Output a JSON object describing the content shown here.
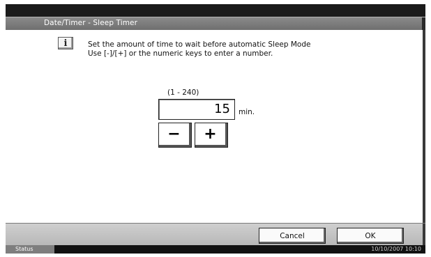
{
  "window": {
    "title": "Date/Timer - Sleep Timer"
  },
  "message": {
    "icon": "info-icon",
    "line1": "Set the amount of time to wait before automatic Sleep Mode",
    "line2": "Use [-]/[+] or the numeric keys to enter a number."
  },
  "timer": {
    "range_label": "(1 - 240)",
    "value": "15",
    "unit": "min.",
    "minus_label": "−",
    "plus_label": "+"
  },
  "actions": {
    "cancel_label": "Cancel",
    "ok_label": "OK"
  },
  "statusbar": {
    "status_label": "Status",
    "datetime": "10/10/2007   10:10"
  }
}
